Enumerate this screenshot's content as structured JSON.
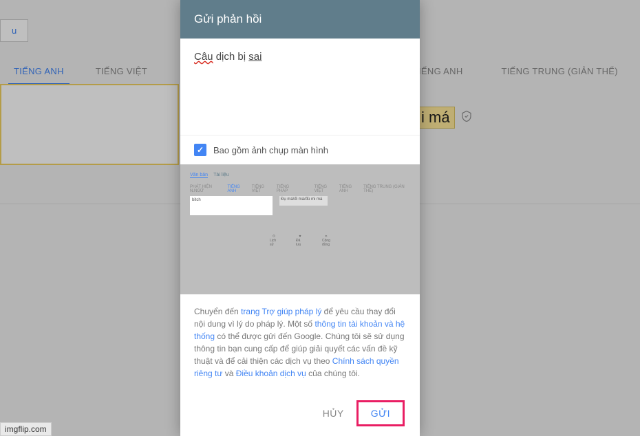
{
  "background": {
    "top_button": "u",
    "tabs_left": [
      "TIẾNG ANH",
      "TIẾNG VIỆT"
    ],
    "tabs_right": [
      "IẾNG ANH",
      "TIẾNG TRUNG (GIẢN THỂ)"
    ],
    "translation_fragment": "i má",
    "active_tab_left": 0
  },
  "modal": {
    "title": "Gửi phản hồi",
    "feedback_prefix": "Câu",
    "feedback_mid": " dịch bị ",
    "feedback_suffix": "sai",
    "checkbox_label": "Bao gồm ảnh chụp màn hình",
    "checkbox_checked": true,
    "footer_parts": {
      "p1": "Chuyển đến ",
      "link1": "trang Trợ giúp pháp lý",
      "p2": " để yêu cầu thay đổi nội dung vì lý do pháp lý. Một số ",
      "link2": "thông tin tài khoản và hệ thống",
      "p3": " có thể được gửi đến Google. Chúng tôi sẽ sử dụng thông tin bạn cung cấp để giúp giải quyết các vấn đề kỹ thuật và để cải thiện các dịch vụ theo ",
      "link3": "Chính sách quyền riêng tư",
      "p4": " và ",
      "link4": "Điều khoản dịch vụ",
      "p5": " của chúng tôi."
    },
    "cancel": "HỦY",
    "submit": "GỬI"
  },
  "watermark": "imgflip.com"
}
